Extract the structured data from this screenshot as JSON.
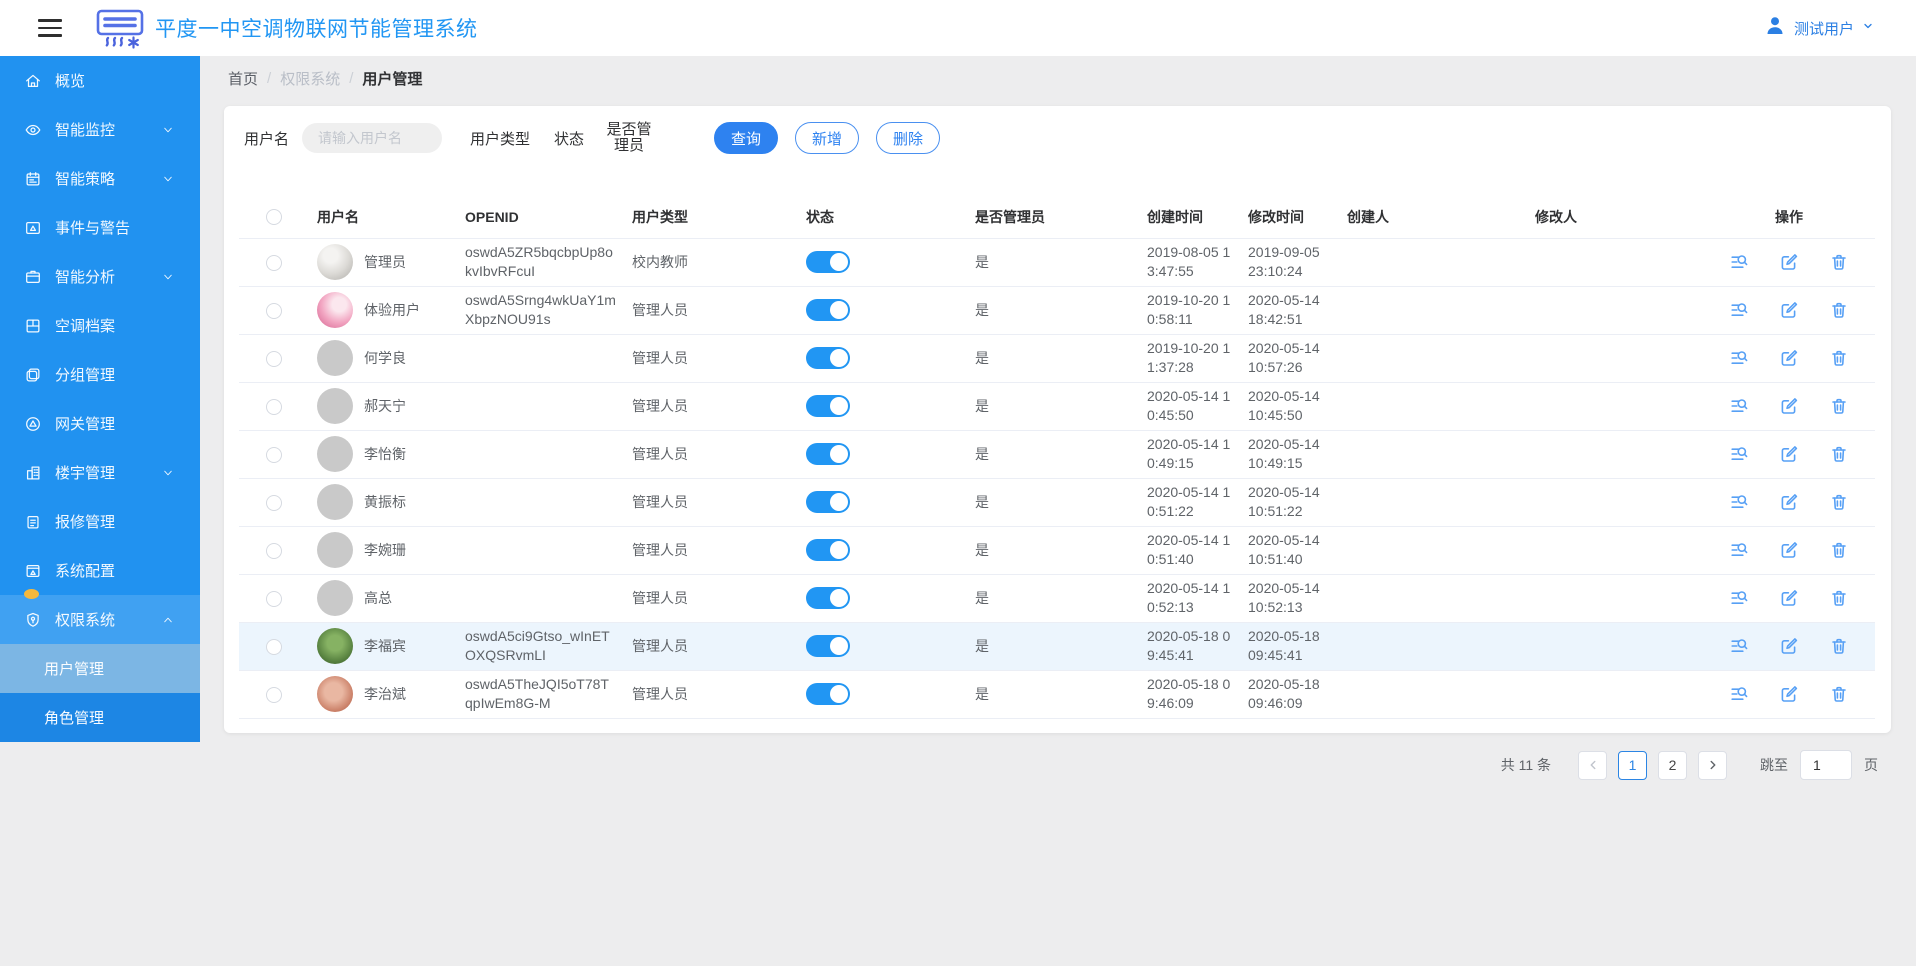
{
  "header": {
    "title": "平度一中空调物联网节能管理系统",
    "user_name": "测试用户"
  },
  "breadcrumb": {
    "items": [
      "首页",
      "权限系统",
      "用户管理"
    ]
  },
  "sidebar": {
    "items": [
      {
        "label": "概览",
        "icon": "home"
      },
      {
        "label": "智能监控",
        "icon": "eye",
        "chevron": "down"
      },
      {
        "label": "智能策略",
        "icon": "strategy",
        "chevron": "down"
      },
      {
        "label": "事件与警告",
        "icon": "alert"
      },
      {
        "label": "智能分析",
        "icon": "analysis",
        "chevron": "down"
      },
      {
        "label": "空调档案",
        "icon": "archive"
      },
      {
        "label": "分组管理",
        "icon": "group"
      },
      {
        "label": "网关管理",
        "icon": "gateway"
      },
      {
        "label": "楼宇管理",
        "icon": "building",
        "chevron": "down"
      },
      {
        "label": "报修管理",
        "icon": "repair"
      },
      {
        "label": "系统配置",
        "icon": "config",
        "badge": true
      },
      {
        "label": "权限系统",
        "icon": "permission",
        "chevron": "up",
        "highlight": true
      }
    ],
    "submenu": [
      {
        "label": "用户管理",
        "active": true
      },
      {
        "label": "角色管理",
        "active": false
      }
    ]
  },
  "filters": {
    "username_label": "用户名",
    "username_placeholder": "请输入用户名",
    "usertype_label": "用户类型",
    "status_label": "状态",
    "admin_label": "是否管理员",
    "search_button": "查询",
    "add_button": "新增",
    "delete_button": "删除"
  },
  "table": {
    "columns": [
      "用户名",
      "OPENID",
      "用户类型",
      "状态",
      "是否管理员",
      "创建时间",
      "修改时间",
      "创建人",
      "修改人",
      "操作"
    ],
    "op_icons": [
      "view-detail",
      "edit",
      "delete"
    ],
    "rows": [
      {
        "name": "管理员",
        "openid": "oswdA5ZR5bqcbpUp8okvIbvRFcuI",
        "avatar": "photo-1",
        "type": "校内教师",
        "status_on": true,
        "is_admin": "是",
        "created": "2019-08-05 13:47:55",
        "modified": "2019-09-05 23:10:24",
        "creator": "",
        "modifier": "",
        "highlight": false
      },
      {
        "name": "体验用户",
        "openid": "oswdA5Srng4wkUaY1mXbpzNOU91s",
        "avatar": "photo-2",
        "type": "管理人员",
        "status_on": true,
        "is_admin": "是",
        "created": "2019-10-20 10:58:11",
        "modified": "2020-05-14 18:42:51",
        "creator": "",
        "modifier": "",
        "highlight": false
      },
      {
        "name": "何学良",
        "openid": "",
        "avatar": "placeholder",
        "type": "管理人员",
        "status_on": true,
        "is_admin": "是",
        "created": "2019-10-20 11:37:28",
        "modified": "2020-05-14 10:57:26",
        "creator": "",
        "modifier": "",
        "highlight": false
      },
      {
        "name": "郝天宁",
        "openid": "",
        "avatar": "placeholder",
        "type": "管理人员",
        "status_on": true,
        "is_admin": "是",
        "created": "2020-05-14 10:45:50",
        "modified": "2020-05-14 10:45:50",
        "creator": "",
        "modifier": "",
        "highlight": false
      },
      {
        "name": "李怡衡",
        "openid": "",
        "avatar": "placeholder",
        "type": "管理人员",
        "status_on": true,
        "is_admin": "是",
        "created": "2020-05-14 10:49:15",
        "modified": "2020-05-14 10:49:15",
        "creator": "",
        "modifier": "",
        "highlight": false
      },
      {
        "name": "黄振标",
        "openid": "",
        "avatar": "placeholder",
        "type": "管理人员",
        "status_on": true,
        "is_admin": "是",
        "created": "2020-05-14 10:51:22",
        "modified": "2020-05-14 10:51:22",
        "creator": "",
        "modifier": "",
        "highlight": false
      },
      {
        "name": "李婉珊",
        "openid": "",
        "avatar": "placeholder",
        "type": "管理人员",
        "status_on": true,
        "is_admin": "是",
        "created": "2020-05-14 10:51:40",
        "modified": "2020-05-14 10:51:40",
        "creator": "",
        "modifier": "",
        "highlight": false
      },
      {
        "name": "高总",
        "openid": "",
        "avatar": "placeholder",
        "type": "管理人员",
        "status_on": true,
        "is_admin": "是",
        "created": "2020-05-14 10:52:13",
        "modified": "2020-05-14 10:52:13",
        "creator": "",
        "modifier": "",
        "highlight": false
      },
      {
        "name": "李福宾",
        "openid": "oswdA5ci9Gtso_wInETOXQSRvmLI",
        "avatar": "photo-9",
        "type": "管理人员",
        "status_on": true,
        "is_admin": "是",
        "created": "2020-05-18 09:45:41",
        "modified": "2020-05-18 09:45:41",
        "creator": "",
        "modifier": "",
        "highlight": true
      },
      {
        "name": "李治斌",
        "openid": "oswdA5TheJQI5oT78TqpIwEm8G-M",
        "avatar": "photo-10",
        "type": "管理人员",
        "status_on": true,
        "is_admin": "是",
        "created": "2020-05-18 09:46:09",
        "modified": "2020-05-18 09:46:09",
        "creator": "",
        "modifier": "",
        "highlight": false
      }
    ]
  },
  "pagination": {
    "total_text": "共 11 条",
    "pages": [
      "1",
      "2"
    ],
    "current_page": "1",
    "jump_label": "跳至",
    "jump_value": "1",
    "page_unit": "页"
  },
  "colors": {
    "primary": "#2196f3",
    "sidebar": "#2192f0",
    "badge": "#f5b83d",
    "toggle-on": "#2196f3",
    "row-hl": "#ecf5fd",
    "opicon": "#57a0f5"
  }
}
